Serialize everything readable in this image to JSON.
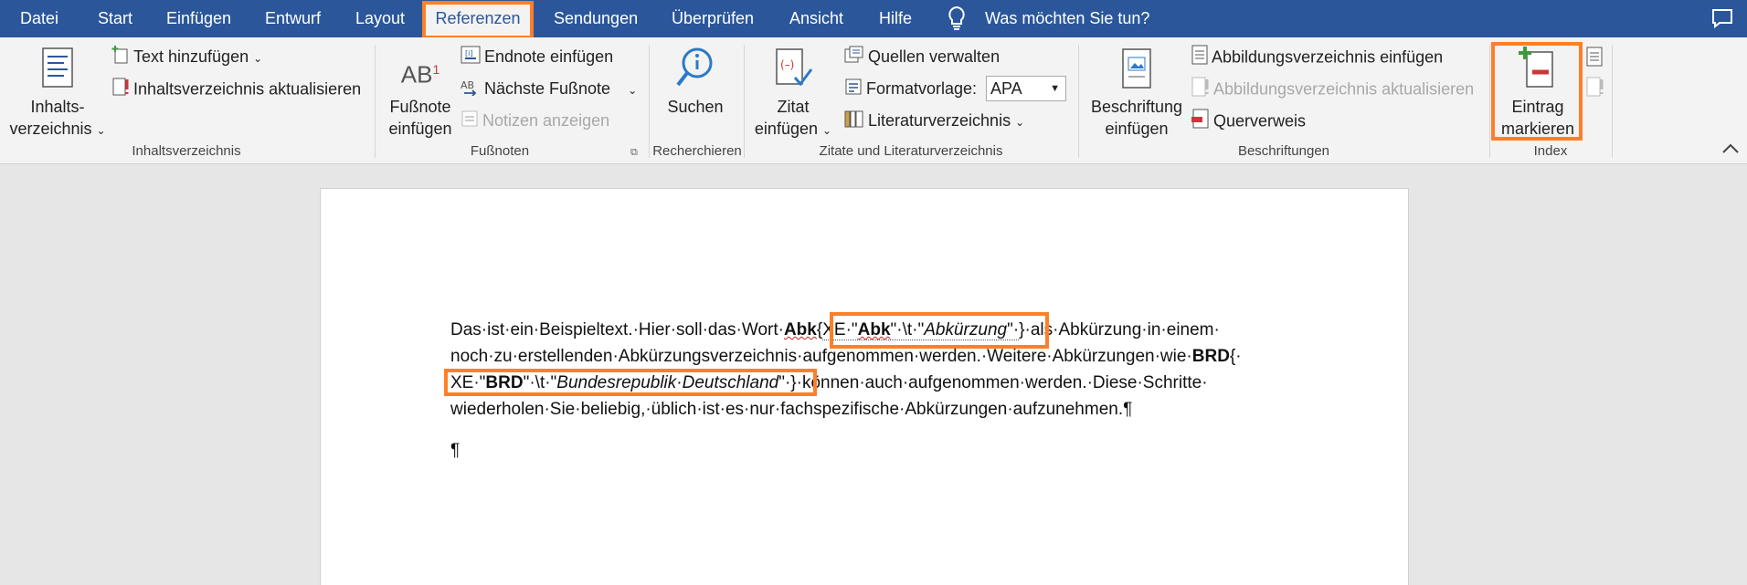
{
  "tabs": [
    "Datei",
    "Start",
    "Einfügen",
    "Entwurf",
    "Layout",
    "Referenzen",
    "Sendungen",
    "Überprüfen",
    "Ansicht",
    "Hilfe"
  ],
  "active_tab": "Referenzen",
  "tell_me": "Was möchten Sie tun?",
  "ribbon": {
    "toc": {
      "big_label_1": "Inhalts-",
      "big_label_2": "verzeichnis",
      "add_text": "Text hinzufügen",
      "update": "Inhaltsverzeichnis aktualisieren",
      "group": "Inhaltsverzeichnis"
    },
    "footnotes": {
      "big_label_1": "Fußnote",
      "big_label_2": "einfügen",
      "endnote": "Endnote einfügen",
      "next": "Nächste Fußnote",
      "show_notes": "Notizen anzeigen",
      "group": "Fußnoten",
      "icon_text": "AB"
    },
    "research": {
      "big_label": "Suchen",
      "group": "Recherchieren"
    },
    "citations": {
      "big_label_1": "Zitat",
      "big_label_2": "einfügen",
      "manage": "Quellen verwalten",
      "style_label": "Formatvorlage:",
      "style_value": "APA",
      "bibliography": "Literaturverzeichnis",
      "group": "Zitate und Literaturverzeichnis"
    },
    "captions": {
      "big_label_1": "Beschriftung",
      "big_label_2": "einfügen",
      "insert_tof": "Abbildungsverzeichnis einfügen",
      "update_tof": "Abbildungsverzeichnis aktualisieren",
      "cross_ref": "Querverweis",
      "group": "Beschriftungen"
    },
    "index": {
      "big_label_1": "Eintrag",
      "big_label_2": "markieren",
      "group": "Index"
    }
  },
  "document": {
    "line1": {
      "a": "Das·ist·ein·Beispieltext.·Hier·soll·das·Wort·",
      "b": "Abk",
      "c": "{",
      "d": "XE·\"",
      "e": "Abk",
      "f": "\"·\\t·\"",
      "g": "Abkürzung",
      "h": "\"·",
      "i": "}",
      "j": "·als·Abkürzung·in·einem·"
    },
    "line2": {
      "a": "noch·zu·erstellenden·Abkürzungsverzeichnis·aufgenommen·werden.·Weitere·Abkürzungen·wie·",
      "b": "BRD",
      "c": "{·"
    },
    "line3": {
      "a": "XE·\"",
      "b": "BRD",
      "c": "\"·\\t·\"",
      "d": "Bundesrepublik·Deutschland",
      "e": "\"·}",
      "f": "·können·auch·aufgenommen·werden.·Diese·Schritte·"
    },
    "line4": "wiederholen·Sie·beliebig,·üblich·ist·es·nur·fachspezifische·Abkürzungen·aufzunehmen.¶",
    "line5": "¶"
  },
  "colors": {
    "ribbon_blue": "#2b579a",
    "highlight": "#ff7f27"
  }
}
